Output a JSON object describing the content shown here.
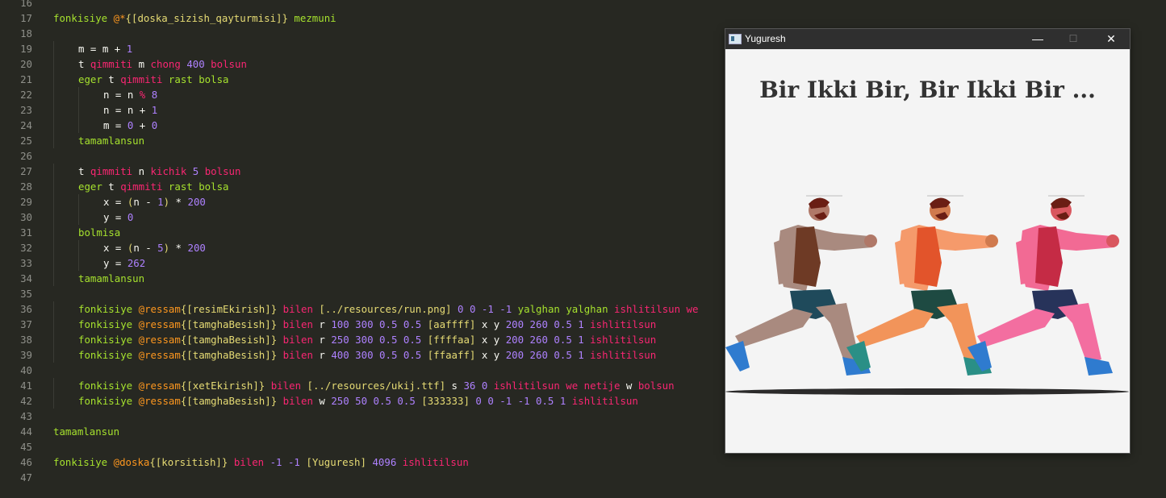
{
  "editor": {
    "lines": [
      {
        "n": "16",
        "segs": []
      },
      {
        "n": "17",
        "segs": [
          [
            "g",
            "fonkisiye "
          ],
          [
            "o",
            "@*"
          ],
          [
            "y",
            "{[doska_sizish_qayturmisi]}"
          ],
          [
            "g",
            " mezmuni"
          ]
        ]
      },
      {
        "n": "18",
        "segs": []
      },
      {
        "n": "19",
        "indent": 1,
        "segs": [
          [
            "w",
            "m = m + "
          ],
          [
            "p",
            "1"
          ]
        ]
      },
      {
        "n": "20",
        "indent": 1,
        "segs": [
          [
            "w",
            "t "
          ],
          [
            "r",
            "qimmiti"
          ],
          [
            "w",
            " m "
          ],
          [
            "r",
            "chong"
          ],
          [
            "w",
            " "
          ],
          [
            "p",
            "400"
          ],
          [
            "w",
            " "
          ],
          [
            "r",
            "bolsun"
          ]
        ]
      },
      {
        "n": "21",
        "indent": 1,
        "segs": [
          [
            "g",
            "eger"
          ],
          [
            "w",
            " t "
          ],
          [
            "r",
            "qimmiti"
          ],
          [
            "w",
            " "
          ],
          [
            "g",
            "rast bolsa"
          ]
        ]
      },
      {
        "n": "22",
        "indent": 2,
        "segs": [
          [
            "w",
            "n = n "
          ],
          [
            "r",
            "%"
          ],
          [
            "w",
            " "
          ],
          [
            "p",
            "8"
          ]
        ]
      },
      {
        "n": "23",
        "indent": 2,
        "segs": [
          [
            "w",
            "n = n + "
          ],
          [
            "p",
            "1"
          ]
        ]
      },
      {
        "n": "24",
        "indent": 2,
        "segs": [
          [
            "w",
            "m = "
          ],
          [
            "p",
            "0"
          ],
          [
            "w",
            " + "
          ],
          [
            "p",
            "0"
          ]
        ]
      },
      {
        "n": "25",
        "indent": 1,
        "segs": [
          [
            "g",
            "tamamlansun"
          ]
        ]
      },
      {
        "n": "26",
        "segs": []
      },
      {
        "n": "27",
        "indent": 1,
        "segs": [
          [
            "w",
            "t "
          ],
          [
            "r",
            "qimmiti"
          ],
          [
            "w",
            " n "
          ],
          [
            "r",
            "kichik"
          ],
          [
            "w",
            " "
          ],
          [
            "p",
            "5"
          ],
          [
            "w",
            " "
          ],
          [
            "r",
            "bolsun"
          ]
        ]
      },
      {
        "n": "28",
        "indent": 1,
        "segs": [
          [
            "g",
            "eger"
          ],
          [
            "w",
            " t "
          ],
          [
            "r",
            "qimmiti"
          ],
          [
            "w",
            " "
          ],
          [
            "g",
            "rast bolsa"
          ]
        ]
      },
      {
        "n": "29",
        "indent": 2,
        "segs": [
          [
            "w",
            "x = "
          ],
          [
            "y",
            "("
          ],
          [
            "w",
            "n - "
          ],
          [
            "p",
            "1"
          ],
          [
            "y",
            ")"
          ],
          [
            "w",
            " * "
          ],
          [
            "p",
            "200"
          ]
        ]
      },
      {
        "n": "30",
        "indent": 2,
        "segs": [
          [
            "w",
            "y = "
          ],
          [
            "p",
            "0"
          ]
        ]
      },
      {
        "n": "31",
        "indent": 1,
        "segs": [
          [
            "g",
            "bolmisa"
          ]
        ]
      },
      {
        "n": "32",
        "indent": 2,
        "segs": [
          [
            "w",
            "x = "
          ],
          [
            "y",
            "("
          ],
          [
            "w",
            "n - "
          ],
          [
            "p",
            "5"
          ],
          [
            "y",
            ")"
          ],
          [
            "w",
            " * "
          ],
          [
            "p",
            "200"
          ]
        ]
      },
      {
        "n": "33",
        "indent": 2,
        "segs": [
          [
            "w",
            "y = "
          ],
          [
            "p",
            "262"
          ]
        ]
      },
      {
        "n": "34",
        "indent": 1,
        "segs": [
          [
            "g",
            "tamamlansun"
          ]
        ]
      },
      {
        "n": "35",
        "segs": []
      },
      {
        "n": "36",
        "indent": 1,
        "segs": [
          [
            "g",
            "fonkisiye "
          ],
          [
            "o",
            "@ressam"
          ],
          [
            "y",
            "{[resimEkirish]}"
          ],
          [
            "r",
            " bilen "
          ],
          [
            "y",
            "[../resources/run.png]"
          ],
          [
            "w",
            " "
          ],
          [
            "p",
            "0"
          ],
          [
            "w",
            " "
          ],
          [
            "p",
            "0"
          ],
          [
            "w",
            " "
          ],
          [
            "p",
            "-1"
          ],
          [
            "w",
            " "
          ],
          [
            "p",
            "-1"
          ],
          [
            "w",
            " "
          ],
          [
            "g",
            "yalghan yalghan"
          ],
          [
            "r",
            " ishlitilsun we"
          ]
        ]
      },
      {
        "n": "37",
        "indent": 1,
        "segs": [
          [
            "g",
            "fonkisiye "
          ],
          [
            "o",
            "@ressam"
          ],
          [
            "y",
            "{[tamghaBesish]}"
          ],
          [
            "r",
            " bilen"
          ],
          [
            "w",
            " r "
          ],
          [
            "p",
            "100 300 0.5 0.5"
          ],
          [
            "w",
            " "
          ],
          [
            "y",
            "[aaffff]"
          ],
          [
            "w",
            " x y "
          ],
          [
            "p",
            "200 260 0.5 1"
          ],
          [
            "r",
            " ishlitilsun"
          ]
        ]
      },
      {
        "n": "38",
        "indent": 1,
        "segs": [
          [
            "g",
            "fonkisiye "
          ],
          [
            "o",
            "@ressam"
          ],
          [
            "y",
            "{[tamghaBesish]}"
          ],
          [
            "r",
            " bilen"
          ],
          [
            "w",
            " r "
          ],
          [
            "p",
            "250 300 0.5 0.5"
          ],
          [
            "w",
            " "
          ],
          [
            "y",
            "[ffffaa]"
          ],
          [
            "w",
            " x y "
          ],
          [
            "p",
            "200 260 0.5 1"
          ],
          [
            "r",
            " ishlitilsun"
          ]
        ]
      },
      {
        "n": "39",
        "indent": 1,
        "segs": [
          [
            "g",
            "fonkisiye "
          ],
          [
            "o",
            "@ressam"
          ],
          [
            "y",
            "{[tamghaBesish]}"
          ],
          [
            "r",
            " bilen"
          ],
          [
            "w",
            " r "
          ],
          [
            "p",
            "400 300 0.5 0.5"
          ],
          [
            "w",
            " "
          ],
          [
            "y",
            "[ffaaff]"
          ],
          [
            "w",
            " x y "
          ],
          [
            "p",
            "200 260 0.5 1"
          ],
          [
            "r",
            " ishlitilsun"
          ]
        ]
      },
      {
        "n": "40",
        "segs": []
      },
      {
        "n": "41",
        "indent": 1,
        "segs": [
          [
            "g",
            "fonkisiye "
          ],
          [
            "o",
            "@ressam"
          ],
          [
            "y",
            "{[xetEkirish]}"
          ],
          [
            "r",
            " bilen "
          ],
          [
            "y",
            "[../resources/ukij.ttf]"
          ],
          [
            "w",
            " s "
          ],
          [
            "p",
            "36 0"
          ],
          [
            "r",
            " ishlitilsun we netije"
          ],
          [
            "w",
            " w "
          ],
          [
            "r",
            "bolsun"
          ]
        ]
      },
      {
        "n": "42",
        "indent": 1,
        "segs": [
          [
            "g",
            "fonkisiye "
          ],
          [
            "o",
            "@ressam"
          ],
          [
            "y",
            "{[tamghaBesish]}"
          ],
          [
            "r",
            " bilen"
          ],
          [
            "w",
            " w "
          ],
          [
            "p",
            "250 50 0.5 0.5"
          ],
          [
            "w",
            " "
          ],
          [
            "y",
            "[333333]"
          ],
          [
            "w",
            " "
          ],
          [
            "p",
            "0 0 -1 -1 0.5 1"
          ],
          [
            "r",
            " ishlitilsun"
          ]
        ]
      },
      {
        "n": "43",
        "segs": []
      },
      {
        "n": "44",
        "segs": [
          [
            "g",
            "tamamlansun"
          ]
        ]
      },
      {
        "n": "45",
        "segs": []
      },
      {
        "n": "46",
        "segs": [
          [
            "g",
            "fonkisiye "
          ],
          [
            "o",
            "@doska"
          ],
          [
            "y",
            "{[korsitish]}"
          ],
          [
            "r",
            " bilen "
          ],
          [
            "p",
            "-1 -1"
          ],
          [
            "w",
            " "
          ],
          [
            "y",
            "[Yuguresh]"
          ],
          [
            "w",
            " "
          ],
          [
            "p",
            "4096"
          ],
          [
            "r",
            " ishlitilsun"
          ]
        ]
      },
      {
        "n": "47",
        "segs": []
      }
    ]
  },
  "window": {
    "title": "Yuguresh",
    "minimize": "—",
    "maximize": "☐",
    "close": "✕",
    "banner": "Bir Ikki Bir, Bir Ikki Bir ...",
    "runners": [
      {
        "skin": "#b07868",
        "shirt": "#a98a7f",
        "vest": "#6e3a25",
        "shorts": "#1f4a5b",
        "pants": "#a98a7f",
        "shoe": "#2f7bcf"
      },
      {
        "skin": "#d07a4e",
        "shirt": "#f59a6b",
        "vest": "#e2542b",
        "shorts": "#1e4a42",
        "pants": "#f2945a",
        "shoe": "#2a8f86"
      },
      {
        "skin": "#d9575f",
        "shirt": "#f26a94",
        "vest": "#c52b45",
        "shorts": "#27335a",
        "pants": "#f36ea0",
        "shoe": "#2f7bcf"
      }
    ]
  }
}
